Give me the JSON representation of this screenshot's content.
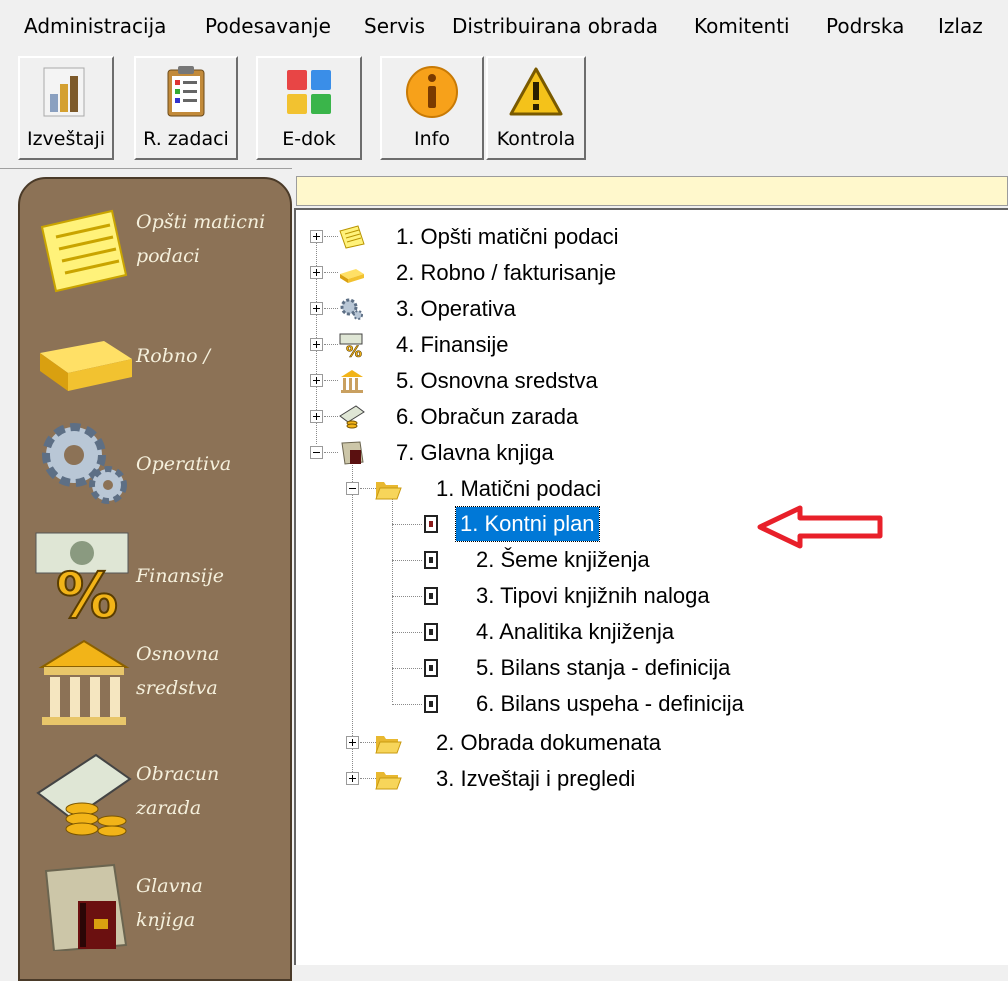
{
  "menu": {
    "items": [
      "Administracija",
      "Podesavanje",
      "Servis",
      "Distribuirana obrada",
      "Komitenti",
      "Podrska",
      "Izlaz"
    ]
  },
  "toolbar": {
    "buttons": [
      {
        "label": "Izveštaji",
        "icon": "bar-chart-icon"
      },
      {
        "label": "R. zadaci",
        "icon": "clipboard-icon"
      },
      {
        "label": "E-dok",
        "icon": "edok-icon"
      },
      {
        "label": "Info",
        "icon": "info-icon"
      },
      {
        "label": "Kontrola",
        "icon": "warning-icon"
      }
    ]
  },
  "sidebar": {
    "items": [
      {
        "label_line1": "Opšti maticni",
        "label_line2": "podaci",
        "icon": "notepad-icon"
      },
      {
        "label_line1": "Robno /",
        "label_line2": "",
        "icon": "gold-bar-icon"
      },
      {
        "label_line1": "Operativa",
        "label_line2": "",
        "icon": "gears-icon"
      },
      {
        "label_line1": "Finansije",
        "label_line2": "",
        "icon": "percent-money-icon"
      },
      {
        "label_line1": "Osnovna",
        "label_line2": "sredstva",
        "icon": "bank-building-icon"
      },
      {
        "label_line1": "Obracun",
        "label_line2": "zarada",
        "icon": "money-coins-icon"
      },
      {
        "label_line1": "Glavna",
        "label_line2": "knjiga",
        "icon": "folder-book-icon"
      }
    ]
  },
  "tree": {
    "root_items": [
      "1. Opšti matični podaci",
      "2. Robno / fakturisanje",
      "3. Operativa",
      "4. Finansije",
      "5. Osnovna sredstva",
      "6. Obračun zarada",
      "7. Glavna knjiga"
    ],
    "glavna_knjiga_children": [
      "1. Matični podaci",
      "2. Obrada dokumenata",
      "3. Izveštaji i pregledi"
    ],
    "maticni_children": [
      "1. Kontni plan",
      "2. Šeme knjiženja",
      "3. Tipovi knjižnih naloga",
      "4. Analitika knjiženja",
      "5. Bilans stanja - definicija",
      "6. Bilans uspeha - definicija"
    ],
    "selected": "1. Kontni plan"
  },
  "colors": {
    "sidebar_bg": "#8c7256",
    "selection": "#0078d7",
    "arrow": "#e8202a",
    "strip": "#fff8cc"
  }
}
